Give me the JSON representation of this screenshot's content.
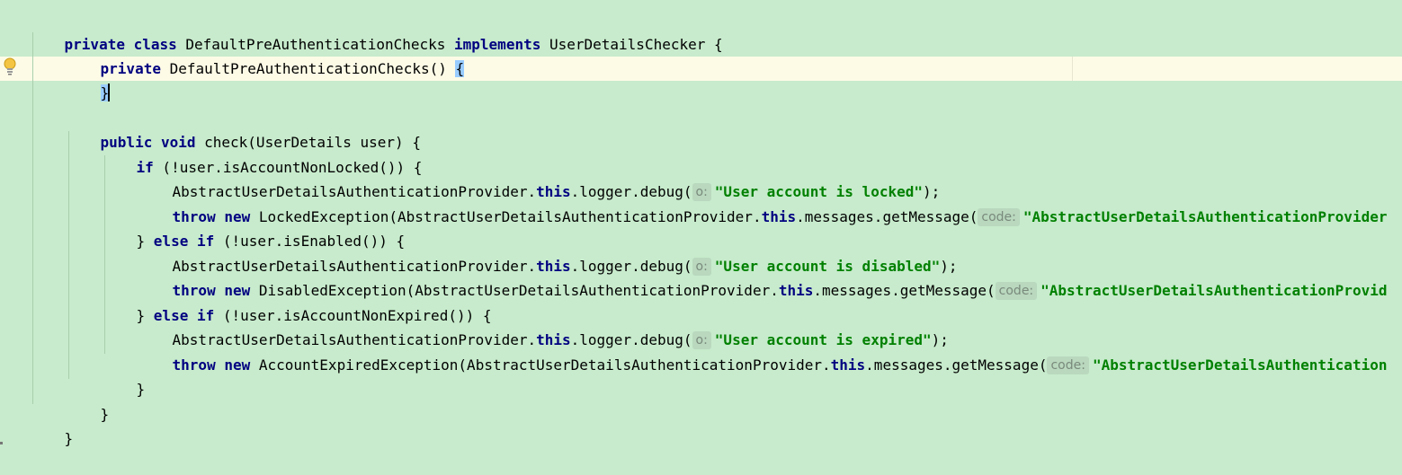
{
  "editor": {
    "background": "#c7ebcc",
    "caret_line_background": "#fdfbe6",
    "keyword_color": "#000080",
    "string_color": "#008000",
    "gutter_icon": "lightbulb-icon",
    "hint_o": "o:",
    "hint_code": "code:",
    "lines": [
      {
        "kw1": "private class",
        "t1": " DefaultPreAuthenticationChecks ",
        "kw2": "implements",
        "t2": " UserDetailsChecker {"
      },
      {
        "kw1": "private",
        "t1": " DefaultPreAuthenticationChecks() ",
        "brace": "{"
      },
      {
        "brace": "}"
      },
      {
        "kw1": "public void",
        "t1": " check(UserDetails user) {"
      },
      {
        "kw1": "if",
        "t1": " (!user.isAccountNonLocked()) {"
      },
      {
        "t1": "AbstractUserDetailsAuthenticationProvider.",
        "kw1": "this",
        "t2": ".logger.debug(",
        "str": "\"User account is locked\"",
        "t3": ");"
      },
      {
        "kw1": "throw new",
        "t1": " LockedException(AbstractUserDetailsAuthenticationProvider.",
        "kw2": "this",
        "t2": ".messages.getMessage(",
        "str": "\"AbstractUserDetailsAuthenticationProvider"
      },
      {
        "t1": "} ",
        "kw1": "else if",
        "t2": " (!user.isEnabled()) {"
      },
      {
        "t1": "AbstractUserDetailsAuthenticationProvider.",
        "kw1": "this",
        "t2": ".logger.debug(",
        "str": "\"User account is disabled\"",
        "t3": ");"
      },
      {
        "kw1": "throw new",
        "t1": " DisabledException(AbstractUserDetailsAuthenticationProvider.",
        "kw2": "this",
        "t2": ".messages.getMessage(",
        "str": "\"AbstractUserDetailsAuthenticationProvid"
      },
      {
        "t1": "} ",
        "kw1": "else if",
        "t2": " (!user.isAccountNonExpired()) {"
      },
      {
        "t1": "AbstractUserDetailsAuthenticationProvider.",
        "kw1": "this",
        "t2": ".logger.debug(",
        "str": "\"User account is expired\"",
        "t3": ");"
      },
      {
        "kw1": "throw new",
        "t1": " AccountExpiredException(AbstractUserDetailsAuthenticationProvider.",
        "kw2": "this",
        "t2": ".messages.getMessage(",
        "str": "\"AbstractUserDetailsAuthentication"
      },
      {
        "t1": "}"
      },
      {
        "t1": "}"
      },
      {
        "t1": "}"
      }
    ]
  }
}
